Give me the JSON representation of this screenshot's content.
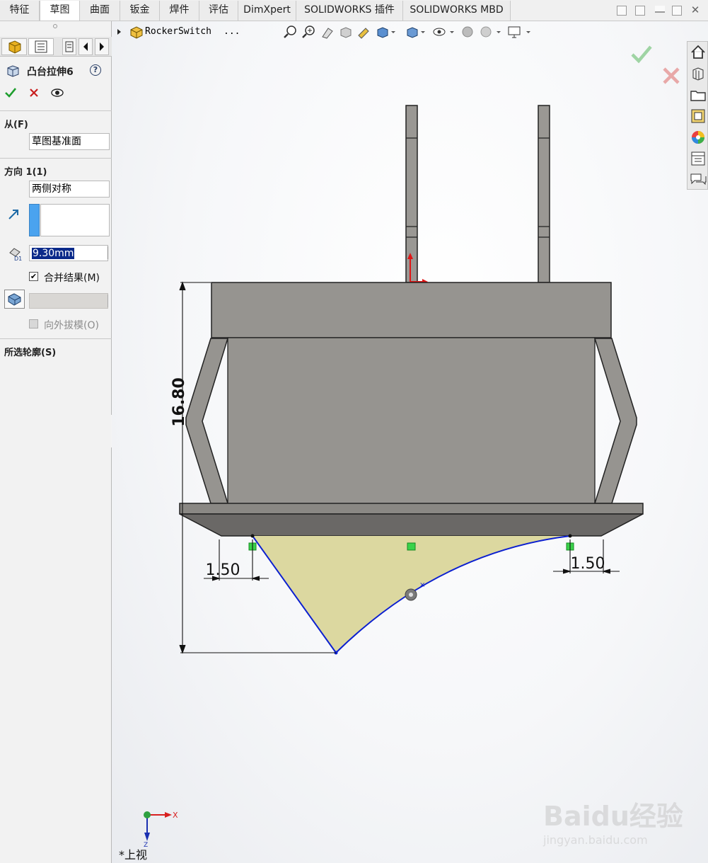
{
  "tabs": [
    {
      "label": "特征"
    },
    {
      "label": "草图"
    },
    {
      "label": "曲面"
    },
    {
      "label": "钣金"
    },
    {
      "label": "焊件"
    },
    {
      "label": "评估"
    },
    {
      "label": "DimXpert"
    },
    {
      "label": "SOLIDWORKS 插件"
    },
    {
      "label": "SOLIDWORKS MBD"
    }
  ],
  "active_tab": "草图",
  "feature": {
    "title": "凸台拉伸6",
    "help": "?"
  },
  "from": {
    "heading": "从(F)",
    "value": "草图基准面"
  },
  "direction1": {
    "heading": "方向 1(1)",
    "end_condition": "两侧对称",
    "depth": "9.30mm",
    "merge_result": "合并结果(M)",
    "merge_checked": true,
    "draft_outward": "向外拔模(O)",
    "draft_checked": false
  },
  "selected_contours": {
    "heading": "所选轮廓(S)"
  },
  "breadcrumb": {
    "part_name": "RockerSwitch",
    "more": "..."
  },
  "dimensions": {
    "height": "16.80",
    "left_offset": "1.50",
    "right_offset": "1.50"
  },
  "view": {
    "orientation": "*上视",
    "x_axis": "X",
    "z_axis": "Z"
  },
  "watermark": {
    "brand": "Baidu经验",
    "url": "jingyan.baidu.com"
  },
  "colors": {
    "accent_green": "#1e9e2e",
    "cancel_red": "#c81e1e",
    "sketch_blue": "#0b1fd0",
    "profile_fill": "#dcd8a0",
    "body_gray": "#969490",
    "dim_black": "#111111"
  },
  "icons": {
    "ok": "check-icon",
    "cancel": "x-icon",
    "preview": "eye-icon",
    "reverse": "reverse-direction-icon",
    "depth": "depth-icon"
  }
}
